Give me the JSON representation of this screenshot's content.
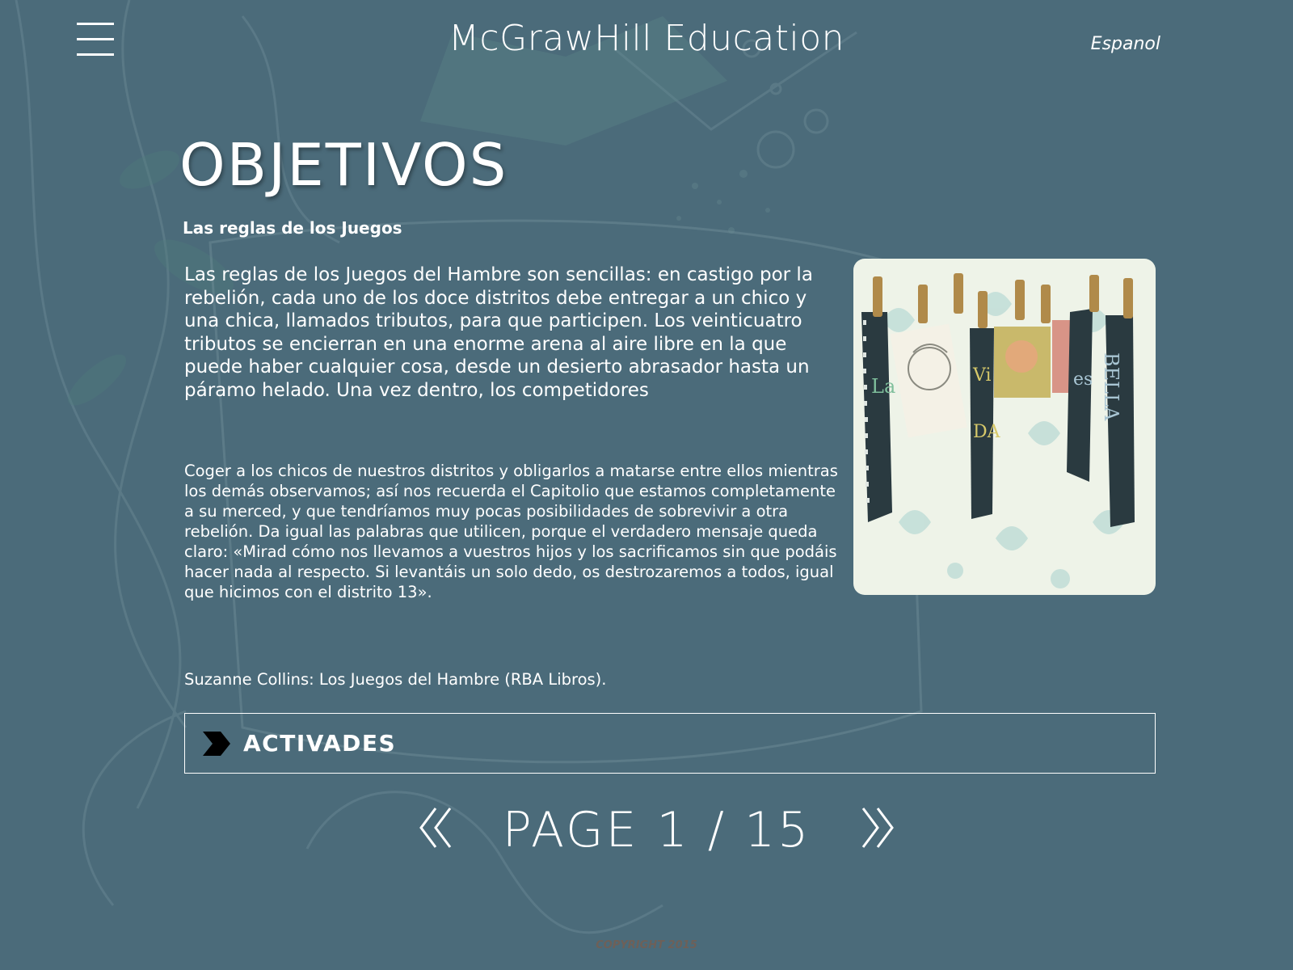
{
  "header": {
    "menu_icon": "hamburger-menu-icon",
    "brand": "McGrawHill Education",
    "language_link": "Espanol"
  },
  "main": {
    "title": "OBJETIVOS",
    "subtitle": "Las reglas de los Juegos",
    "paragraph_1": "Las reglas de los Juegos del Hambre son sencillas: en castigo por la rebelión, cada uno de los doce distritos debe entregar a un chico y una chica, llamados tributos, para que participen. Los veinticuatro tributos se encierran en una enorme arena al aire libre en la que puede haber cualquier cosa, desde un desierto abrasador hasta un páramo helado. Una vez dentro, los competidores",
    "paragraph_2": "Coger a los chicos de nuestros distritos y obligarlos a matarse entre ellos mientras los demás observamos; así nos recuerda el Capitolio que estamos completamente a su merced, y que tendríamos muy pocas posibilidades de sobrevivir a otra rebelión. Da igual las palabras que utilicen, porque el verdadero mensaje queda claro: «Mirad cómo nos llevamos a vuestros hijos y los sacrificamos sin que podáis hacer nada al respecto. Si levantáis un solo dedo, os destrozaremos a todos, igual que hicimos con el distrito 13».",
    "citation": "Suzanne Collins: Los Juegos del Hambre (RBA Libros).",
    "illustration": {
      "icon": "book-cover-illustration",
      "banner_left": "La",
      "banner_middle_top": "Vi",
      "banner_middle_bottom": "DA",
      "banner_right_1": "es",
      "banner_right_2": "BELLA"
    }
  },
  "activities": {
    "icon": "chevron-right-icon",
    "label": "ACTIVADES"
  },
  "pagination": {
    "prev_icon": "double-chevron-left-icon",
    "next_icon": "double-chevron-right-icon",
    "text": "PAGE 1 / 15"
  },
  "footer": {
    "copyright": "COPYRIGHT 2015"
  },
  "colors": {
    "background": "#4b6b7a",
    "text": "#ffffff",
    "copyright": "#6e6058"
  }
}
